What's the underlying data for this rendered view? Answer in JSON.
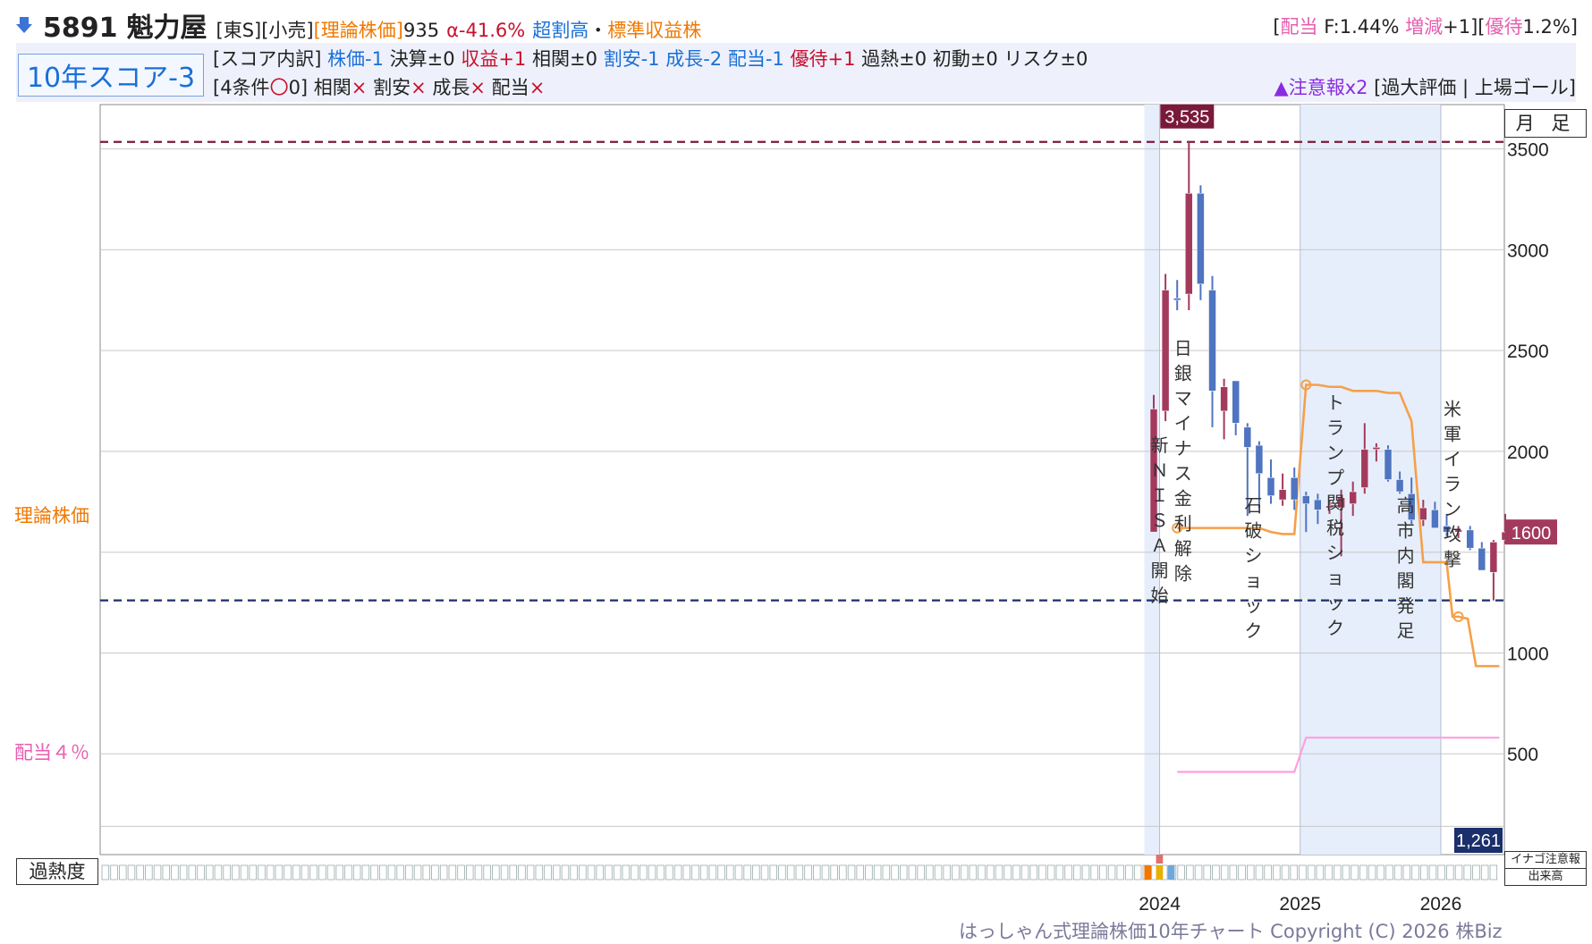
{
  "header": {
    "arrow_icon": "arrow-down-icon",
    "code": "5891",
    "name": "魁力屋",
    "market": "[東S][小売]",
    "theory_label": "[理論株価]",
    "theory_value": "935",
    "alpha": "α-41.6%",
    "valuation": "超割高",
    "dot": "・",
    "category": "標準収益株",
    "right_bracket_open": "[",
    "dividend_label": "配当",
    "dividend_value": " F:1.44% ",
    "change_label": "増減",
    "change_value": "+1][",
    "benefit_label": "優待",
    "benefit_value": "1.2%]"
  },
  "score": {
    "title": "10年スコア-3",
    "line1": [
      {
        "t": "[スコア内訳] ",
        "c": "#222"
      },
      {
        "t": "株価-1 ",
        "c": "#1a6fd6"
      },
      {
        "t": "決算±0 ",
        "c": "#222"
      },
      {
        "t": "収益+1 ",
        "c": "#c8102e"
      },
      {
        "t": "相関±0 ",
        "c": "#222"
      },
      {
        "t": "割安-1 ",
        "c": "#1a6fd6"
      },
      {
        "t": "成長-2 ",
        "c": "#1a6fd6"
      },
      {
        "t": "配当-1 ",
        "c": "#1a6fd6"
      },
      {
        "t": "優待+1 ",
        "c": "#c8102e"
      },
      {
        "t": "過熱±0 ",
        "c": "#222"
      },
      {
        "t": "初動±0 ",
        "c": "#222"
      },
      {
        "t": "リスク±0",
        "c": "#222"
      }
    ],
    "line2": [
      {
        "t": "[4条件",
        "c": "#222"
      },
      {
        "t": "〇",
        "c": "#c8102e"
      },
      {
        "t": "0] 相関",
        "c": "#222"
      },
      {
        "t": "×",
        "c": "#c8102e"
      },
      {
        "t": " 割安",
        "c": "#222"
      },
      {
        "t": "×",
        "c": "#c8102e"
      },
      {
        "t": " 成長",
        "c": "#222"
      },
      {
        "t": "×",
        "c": "#c8102e"
      },
      {
        "t": " 配当",
        "c": "#222"
      },
      {
        "t": "×",
        "c": "#c8102e"
      }
    ],
    "alert": "▲注意報x2",
    "alert_detail": " [過大評価 | 上場ゴール]"
  },
  "labels": {
    "period": "月 足",
    "theory_price_axis": "理論株価",
    "dividend_axis": "配当４％",
    "overheat": "過熱度",
    "inago": "イナゴ注意報",
    "volume": "出来高",
    "copyright": "はっしゃん式理論株価10年チャート Copyright (C) 2026 株Biz"
  },
  "colors": {
    "up": "#a33a5e",
    "down": "#4f74c0",
    "theory_line": "#f5a04a",
    "dividend_line": "#ff9ee0",
    "high_line": "#7a1a3a",
    "low_line": "#1a2f6b",
    "highlight": "#e6eefb"
  },
  "chart_data": {
    "type": "candlestick",
    "title": "5891 魁力屋",
    "y_ticks": [
      500,
      1000,
      1500,
      2000,
      2500,
      3000,
      3500
    ],
    "y_tick_labels": [
      "500",
      "1000",
      "",
      "2000",
      "2500",
      "3000",
      "3500"
    ],
    "ylim": [
      0,
      3720
    ],
    "x_ticks": [
      {
        "label": "2024",
        "index": 0.5
      },
      {
        "label": "2025",
        "index": 12.5
      },
      {
        "label": "2026",
        "index": 24.5
      }
    ],
    "high_mark": {
      "label": "3,535",
      "value": 3535
    },
    "low_mark": {
      "label": "1,261",
      "value": 1261
    },
    "current": {
      "label": "1600",
      "value": 1600
    },
    "candles": [
      {
        "o": 1600,
        "h": 2280,
        "l": 1620,
        "c": 2210
      },
      {
        "o": 2200,
        "h": 2880,
        "l": 2150,
        "c": 2800
      },
      {
        "o": 2760,
        "h": 2850,
        "l": 2700,
        "c": 2750
      },
      {
        "o": 2780,
        "h": 3535,
        "l": 2700,
        "c": 3280
      },
      {
        "o": 3280,
        "h": 3320,
        "l": 2750,
        "c": 2830
      },
      {
        "o": 2800,
        "h": 2870,
        "l": 2120,
        "c": 2300
      },
      {
        "o": 2200,
        "h": 2360,
        "l": 2060,
        "c": 2320
      },
      {
        "o": 2350,
        "h": 2300,
        "l": 2080,
        "c": 2140
      },
      {
        "o": 2120,
        "h": 2140,
        "l": 1680,
        "c": 2020
      },
      {
        "o": 2030,
        "h": 2050,
        "l": 1720,
        "c": 1890
      },
      {
        "o": 1870,
        "h": 1960,
        "l": 1740,
        "c": 1780
      },
      {
        "o": 1760,
        "h": 1890,
        "l": 1730,
        "c": 1810
      },
      {
        "o": 1870,
        "h": 1920,
        "l": 1710,
        "c": 1760
      },
      {
        "o": 1780,
        "h": 1800,
        "l": 1600,
        "c": 1740
      },
      {
        "o": 1760,
        "h": 1790,
        "l": 1640,
        "c": 1710
      },
      {
        "o": 1720,
        "h": 1760,
        "l": 1690,
        "c": 1730
      },
      {
        "o": 1720,
        "h": 1810,
        "l": 1480,
        "c": 1770
      },
      {
        "o": 1740,
        "h": 1850,
        "l": 1680,
        "c": 1800
      },
      {
        "o": 1820,
        "h": 2140,
        "l": 1790,
        "c": 2010
      },
      {
        "o": 2010,
        "h": 2040,
        "l": 1950,
        "c": 2020
      },
      {
        "o": 2010,
        "h": 2030,
        "l": 1850,
        "c": 1860
      },
      {
        "o": 1860,
        "h": 1900,
        "l": 1790,
        "c": 1800
      },
      {
        "o": 1790,
        "h": 1870,
        "l": 1640,
        "c": 1660
      },
      {
        "o": 1660,
        "h": 1760,
        "l": 1630,
        "c": 1720
      },
      {
        "o": 1710,
        "h": 1750,
        "l": 1620,
        "c": 1620
      },
      {
        "o": 1630,
        "h": 1690,
        "l": 1580,
        "c": 1600
      },
      {
        "o": 1600,
        "h": 1630,
        "l": 1570,
        "c": 1610
      },
      {
        "o": 1610,
        "h": 1630,
        "l": 1510,
        "c": 1520
      },
      {
        "o": 1520,
        "h": 1550,
        "l": 1410,
        "c": 1410
      },
      {
        "o": 1400,
        "h": 1560,
        "l": 1261,
        "c": 1550
      },
      {
        "o": 1560,
        "h": 1690,
        "l": 1540,
        "c": 1600
      }
    ],
    "theory_line": [
      [
        2,
        1620
      ],
      [
        3,
        1620
      ],
      [
        4,
        1620
      ],
      [
        5,
        1620
      ],
      [
        6,
        1620
      ],
      [
        7,
        1620
      ],
      [
        8,
        1620
      ],
      [
        9,
        1620
      ],
      [
        10,
        1600
      ],
      [
        11,
        1590
      ],
      [
        12.0,
        1590
      ],
      [
        13,
        2330
      ],
      [
        14,
        2330
      ],
      [
        15,
        2320
      ],
      [
        16,
        2320
      ],
      [
        17,
        2300
      ],
      [
        18,
        2300
      ],
      [
        19,
        2300
      ],
      [
        20,
        2290
      ],
      [
        21,
        2290
      ],
      [
        22,
        2150
      ],
      [
        23,
        1450
      ],
      [
        24,
        1450
      ],
      [
        25,
        1450
      ],
      [
        25.5,
        1180
      ],
      [
        26,
        1180
      ],
      [
        26.8,
        1170
      ],
      [
        27.5,
        935
      ],
      [
        28.5,
        935
      ],
      [
        29.5,
        935
      ]
    ],
    "theory_markers": [
      2,
      13,
      26
    ],
    "dividend_line": [
      [
        2,
        410
      ],
      [
        3,
        410
      ],
      [
        4,
        410
      ],
      [
        5,
        410
      ],
      [
        6,
        410
      ],
      [
        7,
        410
      ],
      [
        8,
        410
      ],
      [
        9,
        410
      ],
      [
        10,
        410
      ],
      [
        11,
        410
      ],
      [
        12,
        410
      ],
      [
        13,
        580
      ],
      [
        14,
        580
      ],
      [
        15,
        580
      ],
      [
        16,
        580
      ],
      [
        17,
        580
      ],
      [
        18,
        580
      ],
      [
        19,
        580
      ],
      [
        20,
        580
      ],
      [
        21,
        580
      ],
      [
        22,
        580
      ],
      [
        23,
        580
      ],
      [
        24,
        580
      ],
      [
        25,
        580
      ],
      [
        26,
        580
      ],
      [
        27,
        580
      ],
      [
        28,
        580
      ],
      [
        29,
        580
      ],
      [
        29.5,
        580
      ]
    ],
    "events": [
      {
        "text": "新ＮＩＳＡ開始",
        "index": 0.5,
        "top": 2000
      },
      {
        "text": "日銀マイナス金利解除",
        "index": 2.5,
        "top": 2480
      },
      {
        "text": "石破ショック",
        "index": 8.5,
        "top": 1700
      },
      {
        "text": "トランプ関税ショック",
        "index": 15.5,
        "top": 2210
      },
      {
        "text": "高市内閣発足",
        "index": 21.5,
        "top": 1700
      },
      {
        "text": "米軍イラン攻撃",
        "index": 25.5,
        "top": 2180
      }
    ]
  }
}
